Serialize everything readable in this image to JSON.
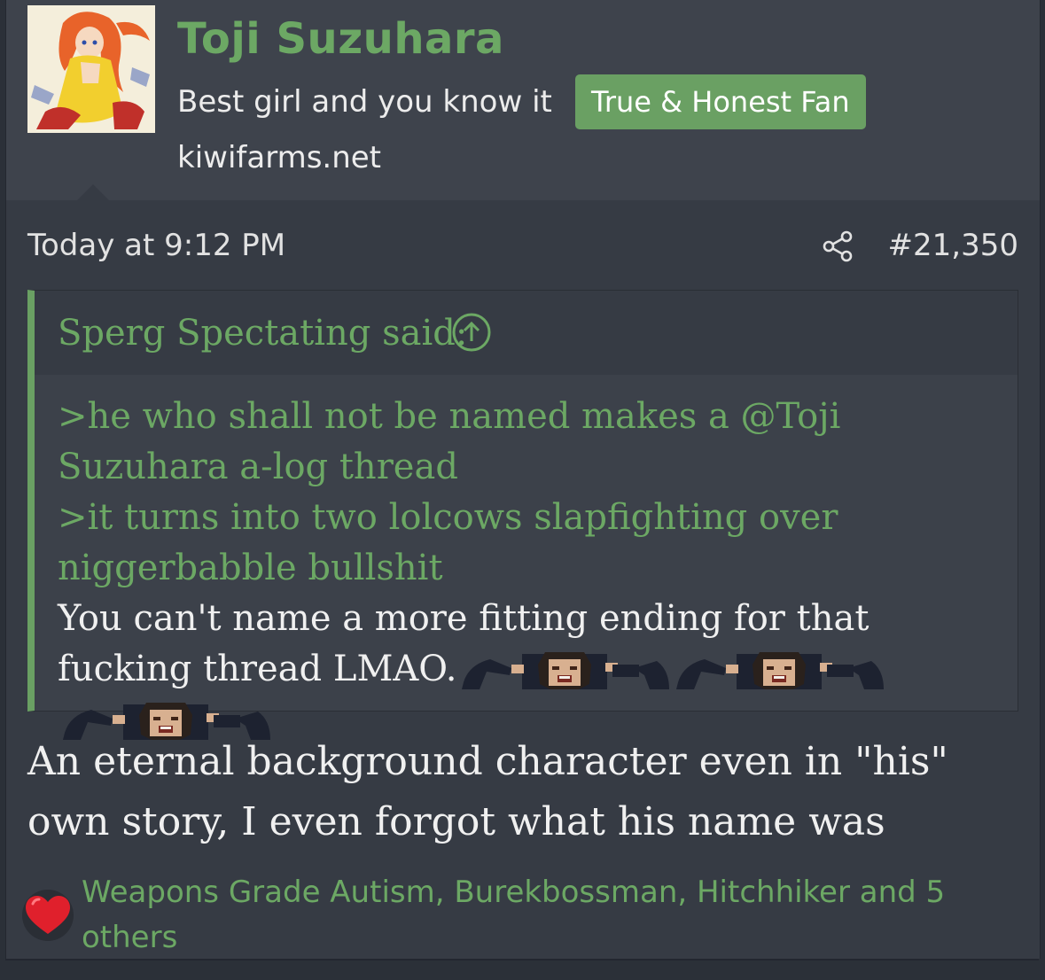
{
  "user": {
    "name": "Toji Suzuhara",
    "title": "Best girl and you know it",
    "badge": "True & Honest Fan",
    "site": "kiwifarms.net",
    "avatar": "anime-girl-avatar"
  },
  "post": {
    "timestamp": "Today at 9:12 PM",
    "number": "#21,350",
    "share_icon": "share-icon"
  },
  "quote": {
    "author_line": "Sperg Spectating said:",
    "expand_icon": "arrow-up-circle-icon",
    "line1_prefix": ">he who shall not be named makes a ",
    "mention": "@Toji Suzuhara",
    "line1_suffix": " a-log thread",
    "line2": ">it turns into two lolcows slapfighting over niggerbabble bullshit",
    "line3": "You can't name a more fitting ending for that fucking thread LMAO.",
    "emoji_icon": "pixel-face-reaction-icon"
  },
  "reply": {
    "text": "An eternal background character even in \"his\" own story, I even forgot what his name was"
  },
  "reactions": {
    "icon": "heart-icon",
    "names": "Weapons Grade Autism, Burekbossman, Hitchhiker and 5 others"
  },
  "colors": {
    "accent_green": "#6ca864",
    "badge_bg": "#6aa063",
    "post_bg": "#363b44",
    "header_bg": "#3e434c",
    "text": "#f0f0f0",
    "heart": "#e0202c"
  }
}
